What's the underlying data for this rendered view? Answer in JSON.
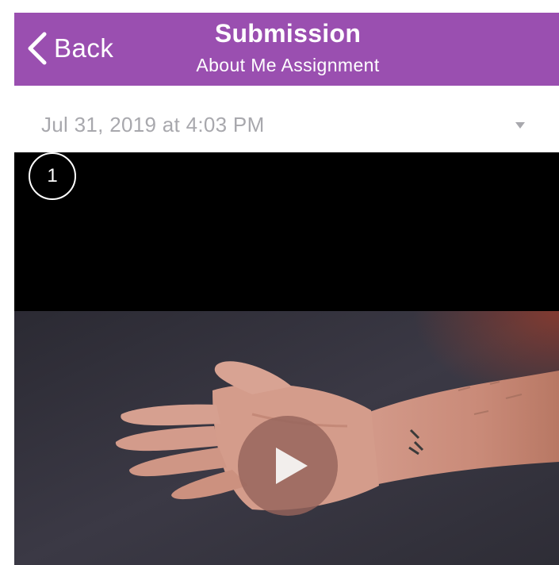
{
  "navbar": {
    "back_label": "Back",
    "title": "Submission",
    "subtitle": "About Me Assignment",
    "background_color": "#9a4fb0"
  },
  "submission": {
    "date": "Jul 31, 2019 at 4:03 PM",
    "dropdown_icon": "caret-down-icon"
  },
  "video": {
    "play_icon": "play-icon",
    "state": "paused"
  },
  "annotation": {
    "step_number": "1"
  }
}
